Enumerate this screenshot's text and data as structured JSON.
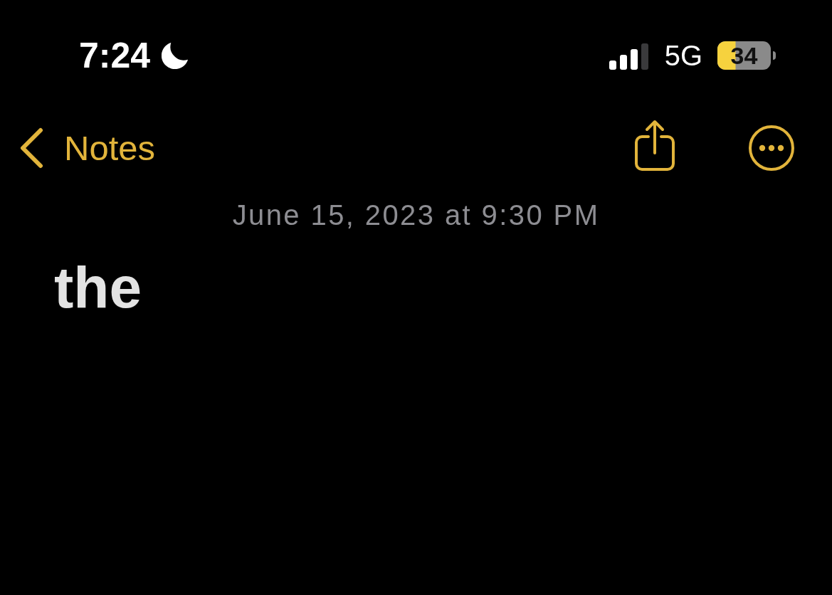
{
  "status_bar": {
    "time": "7:24",
    "network": "5G",
    "battery": {
      "label": "34",
      "low_power_mode": true
    }
  },
  "nav_bar": {
    "back_label": "Notes"
  },
  "note": {
    "date": "June 15, 2023 at 9:30 PM",
    "body": "the"
  }
}
